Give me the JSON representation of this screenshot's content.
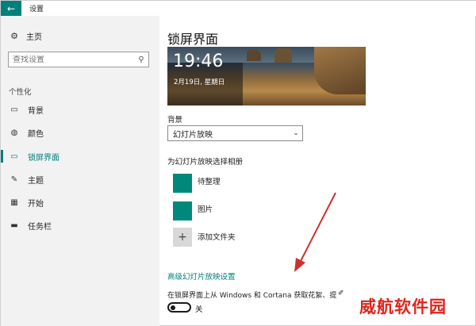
{
  "window": {
    "title": "设置"
  },
  "sidebar": {
    "home_label": "主页",
    "search_placeholder": "查找设置",
    "section_label": "个性化",
    "items": [
      {
        "label": "背景",
        "icon": "picture-icon"
      },
      {
        "label": "颜色",
        "icon": "palette-icon"
      },
      {
        "label": "锁屏界面",
        "icon": "lock-screen-icon",
        "active": true
      },
      {
        "label": "主题",
        "icon": "theme-icon"
      },
      {
        "label": "开始",
        "icon": "start-icon"
      },
      {
        "label": "任务栏",
        "icon": "taskbar-icon"
      }
    ]
  },
  "main": {
    "title": "锁屏界面",
    "preview": {
      "time": "19:46",
      "date": "2月19日, 星期日"
    },
    "background_label": "背景",
    "background_select": "幻灯片放映",
    "album_label": "为幻灯片放映选择相册",
    "albums": [
      {
        "name": "待整理"
      },
      {
        "name": "图片"
      }
    ],
    "add_folder_label": "添加文件夹",
    "advanced_link": "高级幻灯片放映设置",
    "cortana_text": "在锁屏界面上从 Windows 和 Cortana 获取花絮、提",
    "toggle_state": "关"
  },
  "colors": {
    "accent": "#00807a",
    "album_swatch": "#00897b",
    "watermark": "#e0241b",
    "arrow": "#d0302a"
  },
  "watermark": "威航软件园"
}
